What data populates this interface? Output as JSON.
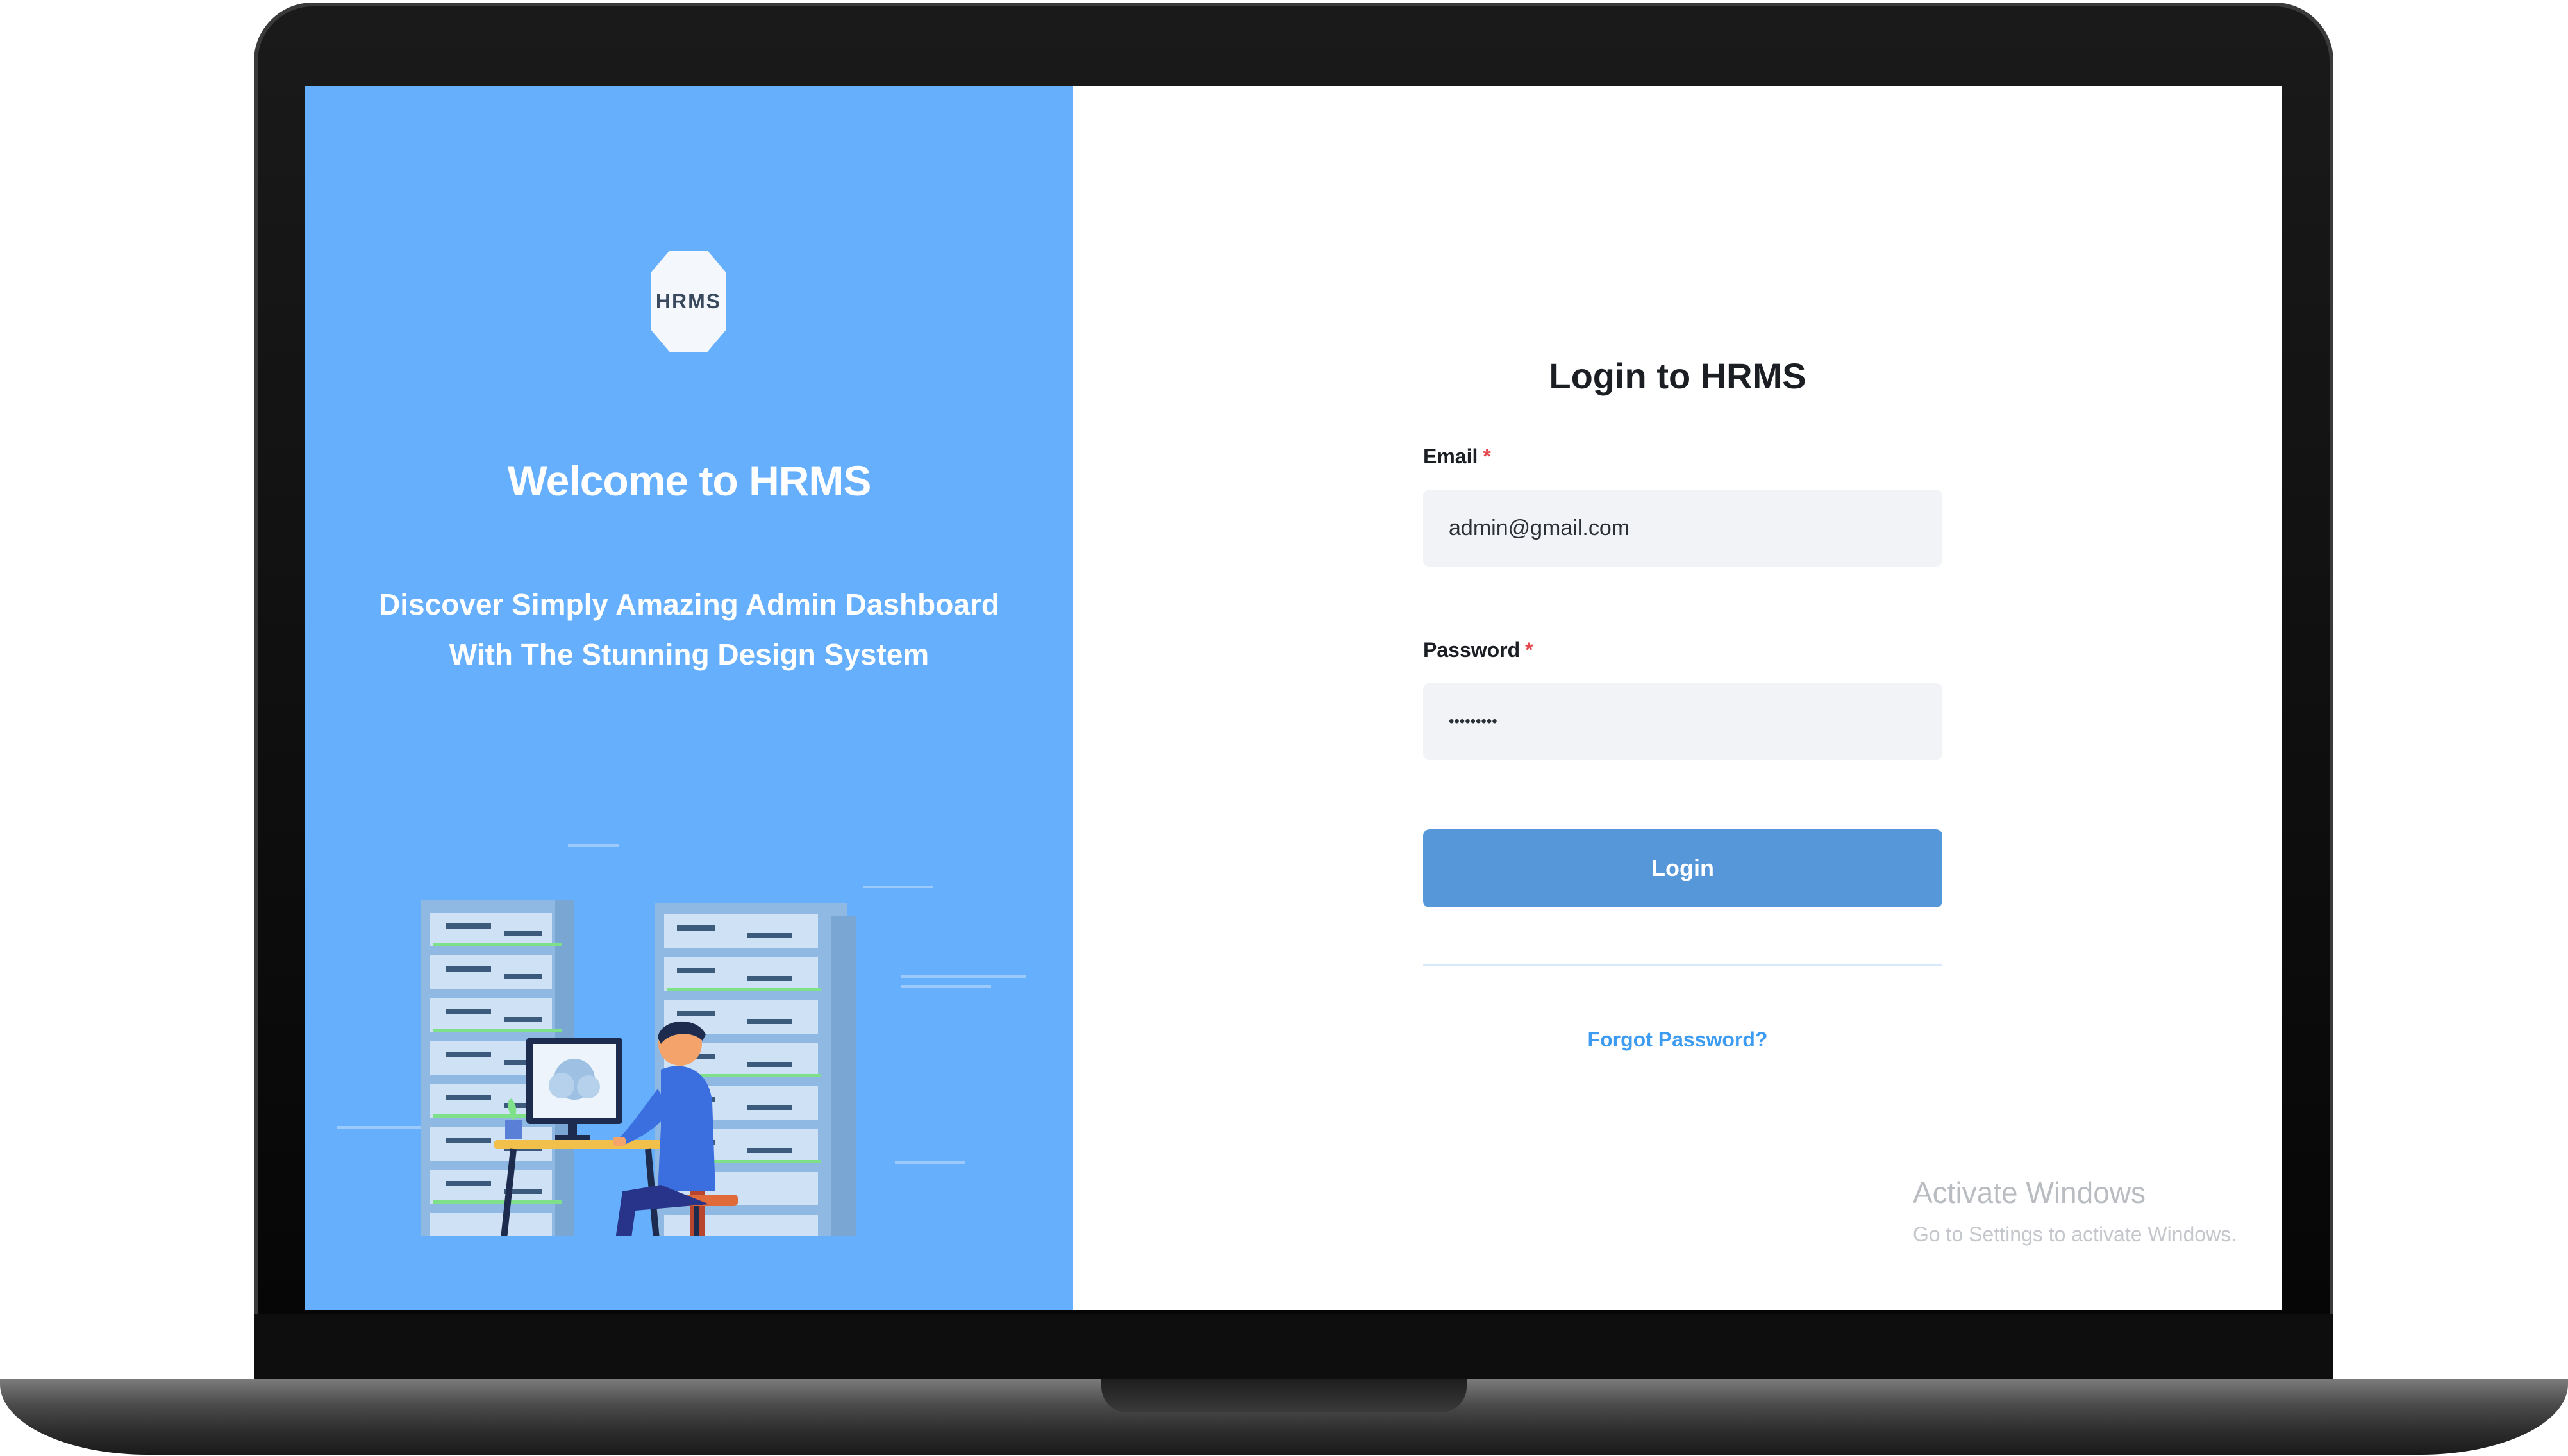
{
  "left_panel": {
    "logo_text": "HRMS",
    "welcome_title": "Welcome to HRMS",
    "subtitle_line1": "Discover Simply Amazing Admin Dashboard",
    "subtitle_line2": "With The Stunning Design System"
  },
  "login": {
    "title": "Login to HRMS",
    "email_label": "Email",
    "email_value": "admin@gmail.com",
    "password_label": "Password",
    "password_value": "•••••••••",
    "required_marker": "*",
    "login_button": "Login",
    "forgot_link": "Forgot Password?"
  },
  "watermark": {
    "title": "Activate Windows",
    "subtitle": "Go to Settings to activate Windows."
  },
  "colors": {
    "left_panel_bg": "#65affc",
    "login_button": "#5597d8",
    "link": "#3d9cf1",
    "required": "#e5484d"
  },
  "icons": [
    "hrms-logo-icon",
    "server-desk-illustration"
  ]
}
